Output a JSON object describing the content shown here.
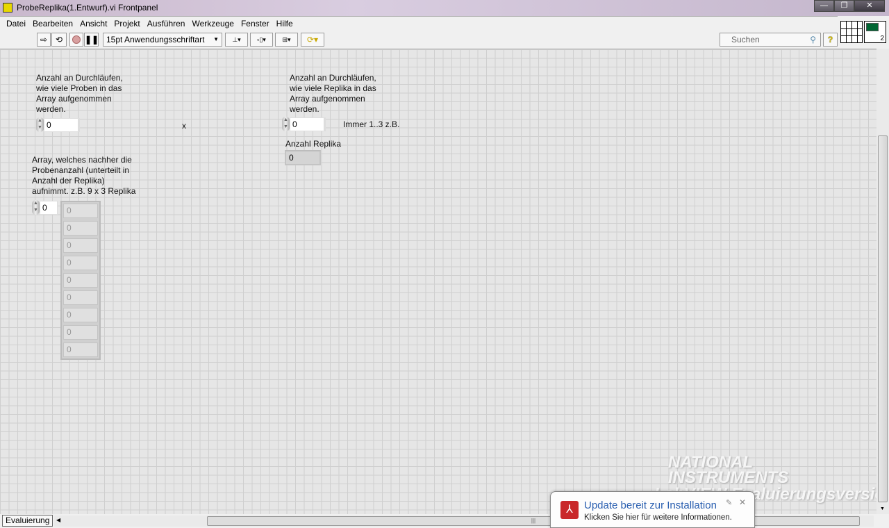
{
  "window": {
    "title": "ProbeReplika(1.Entwurf).vi Frontpanel",
    "minimize": "—",
    "restore": "❐",
    "close": "✕"
  },
  "menu": [
    "Datei",
    "Bearbeiten",
    "Ansicht",
    "Projekt",
    "Ausführen",
    "Werkzeuge",
    "Fenster",
    "Hilfe"
  ],
  "toolbar": {
    "font": "15pt Anwendungsschriftart",
    "search_placeholder": "Suchen",
    "help": "?",
    "connector_num": "2"
  },
  "panel": {
    "label1": "Anzahl an Durchläufen,\nwie viele Proben in das\nArray aufgenommen\nwerden.",
    "value1": "0",
    "x_label": "x",
    "label2": "Anzahl an Durchläufen,\nwie viele Replika in das\nArray aufgenommen\nwerden.",
    "value2": "0",
    "note2": "Immer 1..3 z.B.",
    "replika_label": "Anzahl Replika",
    "replika_value": "0",
    "array_label": "Array, welches nachher die\nProbenanzahl (unterteilt in\nAnzahl der Replika)\naufnimmt. z.B. 9 x 3 Replika",
    "array_index": "0",
    "array_values": [
      "0",
      "0",
      "0",
      "0",
      "0",
      "0",
      "0",
      "0",
      "0"
    ]
  },
  "watermark": {
    "line1": "NATIONAL",
    "line2": "INSTRUMENTS",
    "line3": "LabVIEW Evaluierungsversion"
  },
  "status": {
    "eval": "Evaluierung"
  },
  "toast": {
    "title": "Update bereit zur Installation",
    "text": "Klicken Sie hier für weitere Informationen.",
    "close": "✕"
  }
}
